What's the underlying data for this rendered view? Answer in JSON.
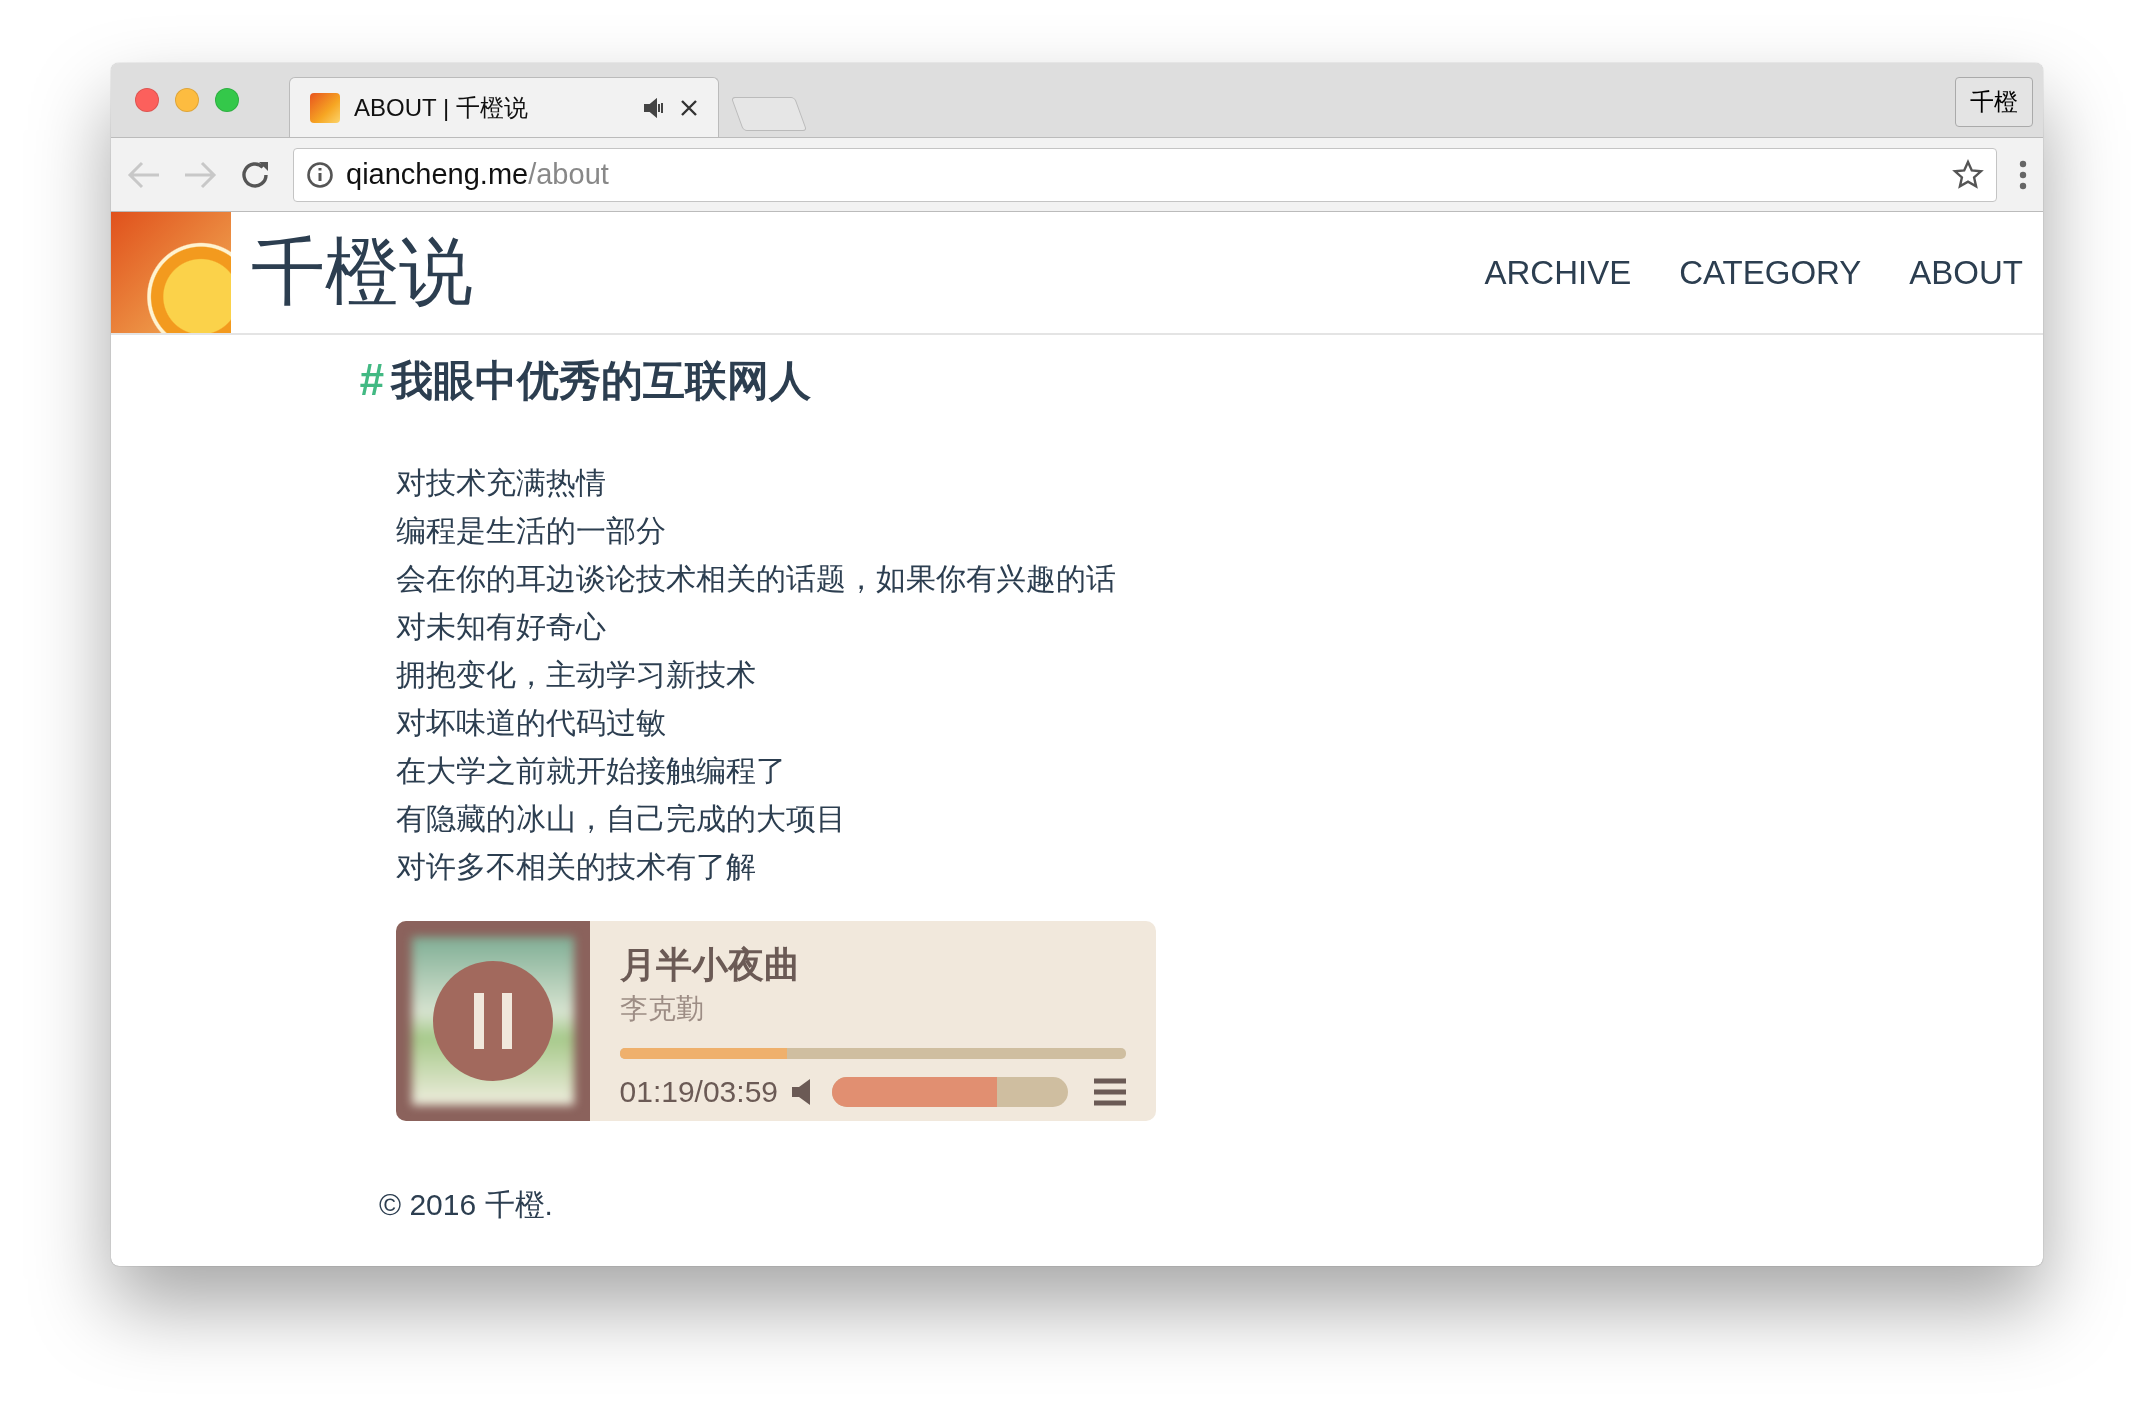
{
  "browser": {
    "tab": {
      "title": "ABOUT | 千橙说",
      "audio": true
    },
    "profile": "千橙",
    "url": {
      "host": "qiancheng.me",
      "path": "/about"
    }
  },
  "site": {
    "title": "千橙说",
    "nav": [
      {
        "label": "ARCHIVE",
        "selected": false
      },
      {
        "label": "CATEGORY",
        "selected": false
      },
      {
        "label": "ABOUT",
        "selected": false
      }
    ]
  },
  "article": {
    "mark": "#",
    "heading": "我眼中优秀的互联网人",
    "lines": [
      "对技术充满热情",
      "编程是生活的一部分",
      "会在你的耳边谈论技术相关的话题，如果你有兴趣的话",
      "对未知有好奇心",
      "拥抱变化，主动学习新技术",
      "对坏味道的代码过敏",
      "在大学之前就开始接触编程了",
      "有隐藏的冰山，自己完成的大项目",
      "对许多不相关的技术有了解"
    ]
  },
  "player": {
    "title": "月半小夜曲",
    "artist": "李克勤",
    "playing": true,
    "progress": {
      "level": 0.33
    },
    "time": "01:19/03:59",
    "volume": {
      "level": 0.7
    }
  },
  "footer": "© 2016 千橙."
}
